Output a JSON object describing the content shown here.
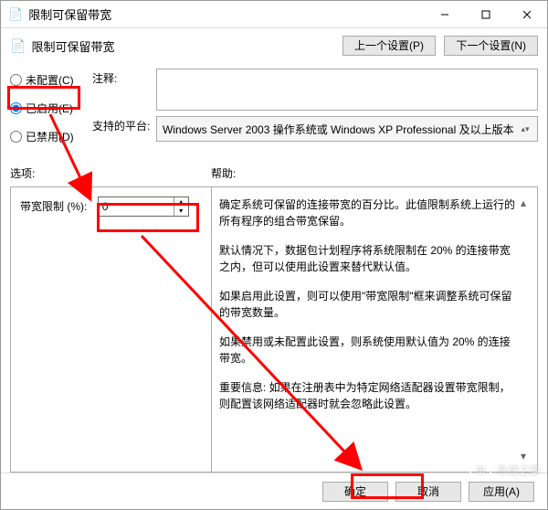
{
  "window": {
    "title": "限制可保留带宽",
    "header_title": "限制可保留带宽"
  },
  "nav": {
    "prev": "上一个设置(P)",
    "next": "下一个设置(N)"
  },
  "radios": {
    "not_configured": "未配置(C)",
    "enabled": "已启用(E)",
    "disabled": "已禁用(D)"
  },
  "labels": {
    "comment": "注释:",
    "platform": "支持的平台:",
    "options": "选项:",
    "help": "帮助:",
    "bandwidth_limit": "带宽限制 (%):"
  },
  "values": {
    "platform_text": "Windows Server 2003 操作系统或 Windows XP Professional 及以上版本",
    "bandwidth_value": "0"
  },
  "help": {
    "p1": "确定系统可保留的连接带宽的百分比。此值限制系统上运行的所有程序的组合带宽保留。",
    "p2": "默认情况下，数据包计划程序将系统限制在 20% 的连接带宽之内，但可以使用此设置来替代默认值。",
    "p3": "如果启用此设置，则可以使用\"带宽限制\"框来调整系统可保留的带宽数量。",
    "p4": "如果禁用或未配置此设置，则系统使用默认值为 20% 的连接带宽。",
    "p5": "重要信息: 如果在注册表中为特定网络适配器设置带宽限制，则配置该网络适配器时就会忽略此设置。"
  },
  "footer": {
    "ok": "确定",
    "cancel": "取消",
    "apply": "应用(A)"
  },
  "watermark": "系统之家"
}
